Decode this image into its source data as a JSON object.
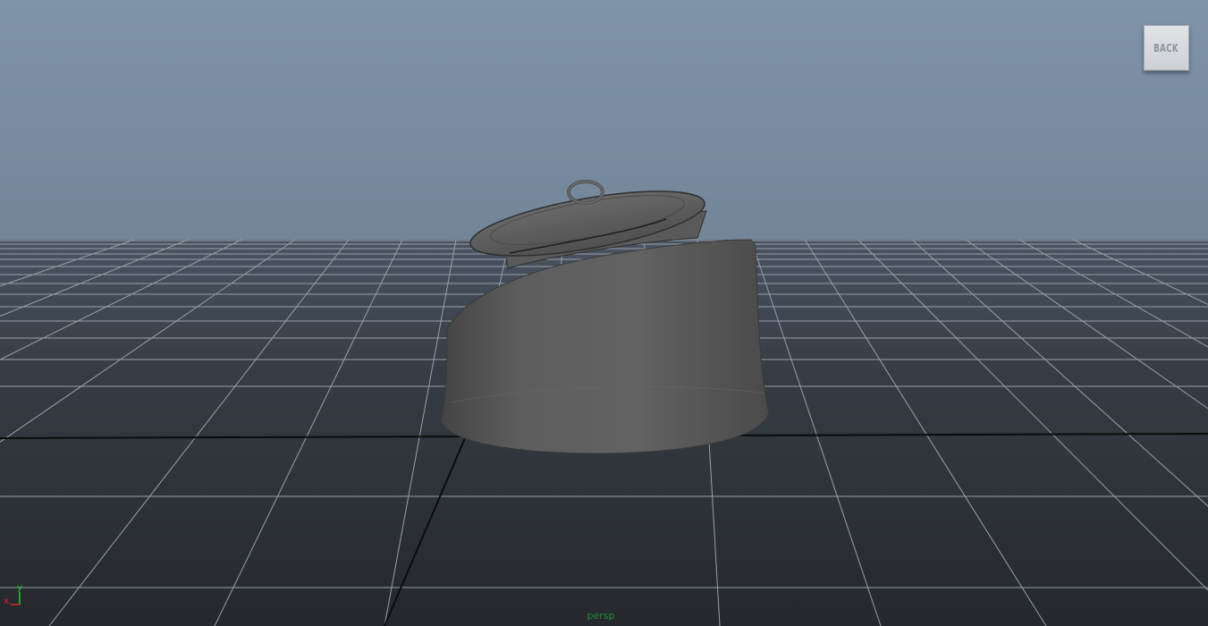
{
  "viewport": {
    "camera_label": "persp",
    "view_cube_label": "BACK"
  },
  "axis_gizmo": {
    "x_label": "x",
    "y_label": "y",
    "x_color": "#e02020",
    "y_color": "#20d020"
  },
  "colors": {
    "sky_top": "#7f93a9",
    "sky_horizon": "#5c6a79",
    "floor": "#2f3338",
    "grid_line": "#9aa1a8",
    "grid_axis": "#0a0a0a",
    "object": "#5b5b5b"
  },
  "scene_object": {
    "name_icon": "teapot-lid-mesh-icon"
  }
}
